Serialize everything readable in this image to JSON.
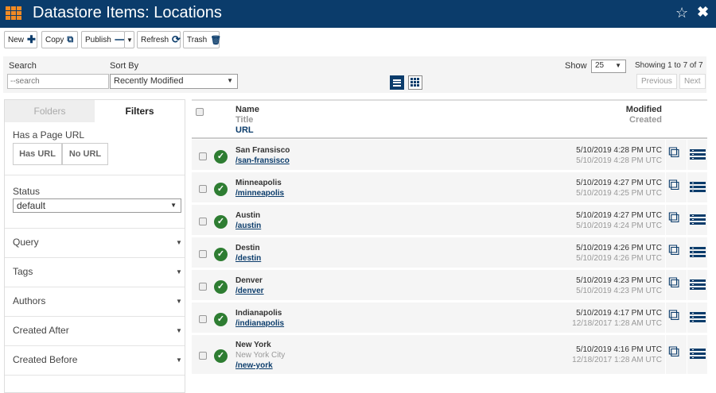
{
  "window": {
    "title": "Datastore Items: Locations"
  },
  "toolbar": {
    "new_label": "New",
    "copy_label": "Copy",
    "publish_label": "Publish",
    "refresh_label": "Refresh",
    "trash_label": "Trash"
  },
  "filters": {
    "search_label": "Search",
    "search_placeholder": "--search",
    "sort_label": "Sort By",
    "sort_value": "Recently Modified",
    "show_label": "Show",
    "show_value": "25",
    "showing_text": "Showing 1 to 7 of 7",
    "prev_label": "Previous",
    "next_label": "Next"
  },
  "sidebar": {
    "tab_folders": "Folders",
    "tab_filters": "Filters",
    "page_url_label": "Has a Page URL",
    "has_url_label": "Has URL",
    "no_url_label": "No URL",
    "status_label": "Status",
    "status_value": "default",
    "sections": [
      "Query",
      "Tags",
      "Authors",
      "Created After",
      "Created Before"
    ]
  },
  "table": {
    "headers": {
      "name": "Name",
      "title": "Title",
      "url": "URL",
      "modified": "Modified",
      "created": "Created"
    },
    "rows": [
      {
        "name": "San Fransisco",
        "title": "",
        "url": "/san-fransisco",
        "modified": "5/10/2019 4:28 PM UTC",
        "created": "5/10/2019 4:28 PM UTC"
      },
      {
        "name": "Minneapolis",
        "title": "",
        "url": "/minneapolis",
        "modified": "5/10/2019 4:27 PM UTC",
        "created": "5/10/2019 4:25 PM UTC"
      },
      {
        "name": "Austin",
        "title": "",
        "url": "/austin",
        "modified": "5/10/2019 4:27 PM UTC",
        "created": "5/10/2019 4:24 PM UTC"
      },
      {
        "name": "Destin",
        "title": "",
        "url": "/destin",
        "modified": "5/10/2019 4:26 PM UTC",
        "created": "5/10/2019 4:26 PM UTC"
      },
      {
        "name": "Denver",
        "title": "",
        "url": "/denver",
        "modified": "5/10/2019 4:23 PM UTC",
        "created": "5/10/2019 4:23 PM UTC"
      },
      {
        "name": "Indianapolis",
        "title": "",
        "url": "/indianapolis",
        "modified": "5/10/2019 4:17 PM UTC",
        "created": "12/18/2017 1:28 AM UTC"
      },
      {
        "name": "New York",
        "title": "New York City",
        "url": "/new-york",
        "modified": "5/10/2019 4:16 PM UTC",
        "created": "12/18/2017 1:28 AM UTC"
      }
    ]
  },
  "colors": {
    "header_bg": "#0b3c6b",
    "accent_orange": "#f08a24",
    "status_green": "#2e7d32"
  },
  "icons": {
    "app": "grid-icon",
    "favorite": "star-icon",
    "close": "close-icon",
    "open": "external-link-icon",
    "menu": "menu-icon"
  }
}
